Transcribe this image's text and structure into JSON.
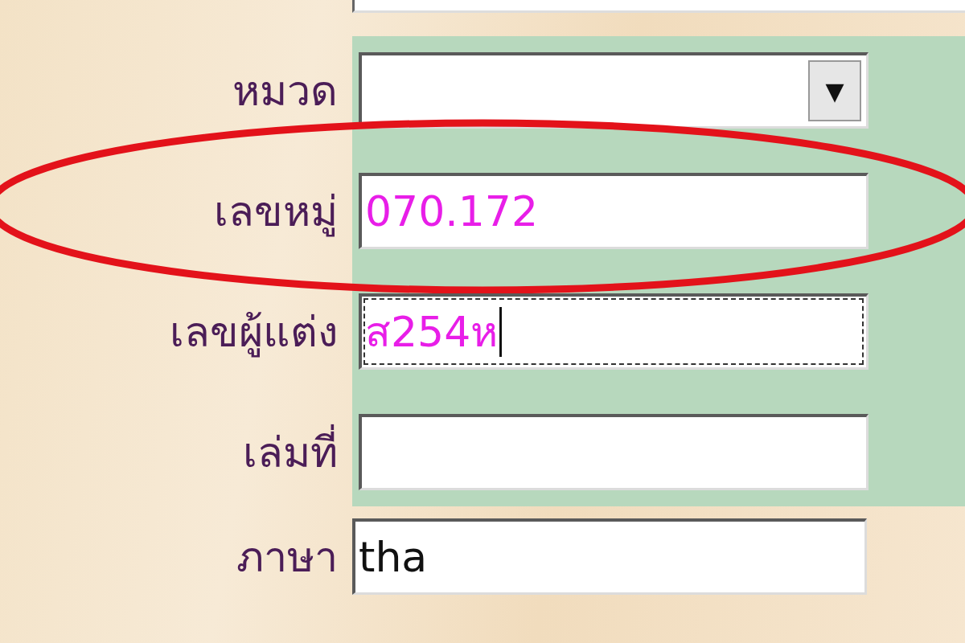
{
  "fields": [
    {
      "label": "หมวด",
      "kind": "dropdown",
      "glyph": "▼",
      "focused": false,
      "circled": false
    },
    {
      "label": "เลขหมู่",
      "kind": "text",
      "value": "070.172",
      "color": "#e81ee8",
      "focused": false,
      "circled": true
    },
    {
      "label": "เลขผู้แต่ง",
      "kind": "text",
      "value": "ส254ห",
      "color": "#e81ee8",
      "focused": true,
      "circled": false
    },
    {
      "label": "เล่มที่",
      "kind": "text",
      "focused": false,
      "circled": false
    }
  ],
  "language_field": {
    "label": "ภาษา",
    "value": "tha",
    "color": "#111111"
  }
}
